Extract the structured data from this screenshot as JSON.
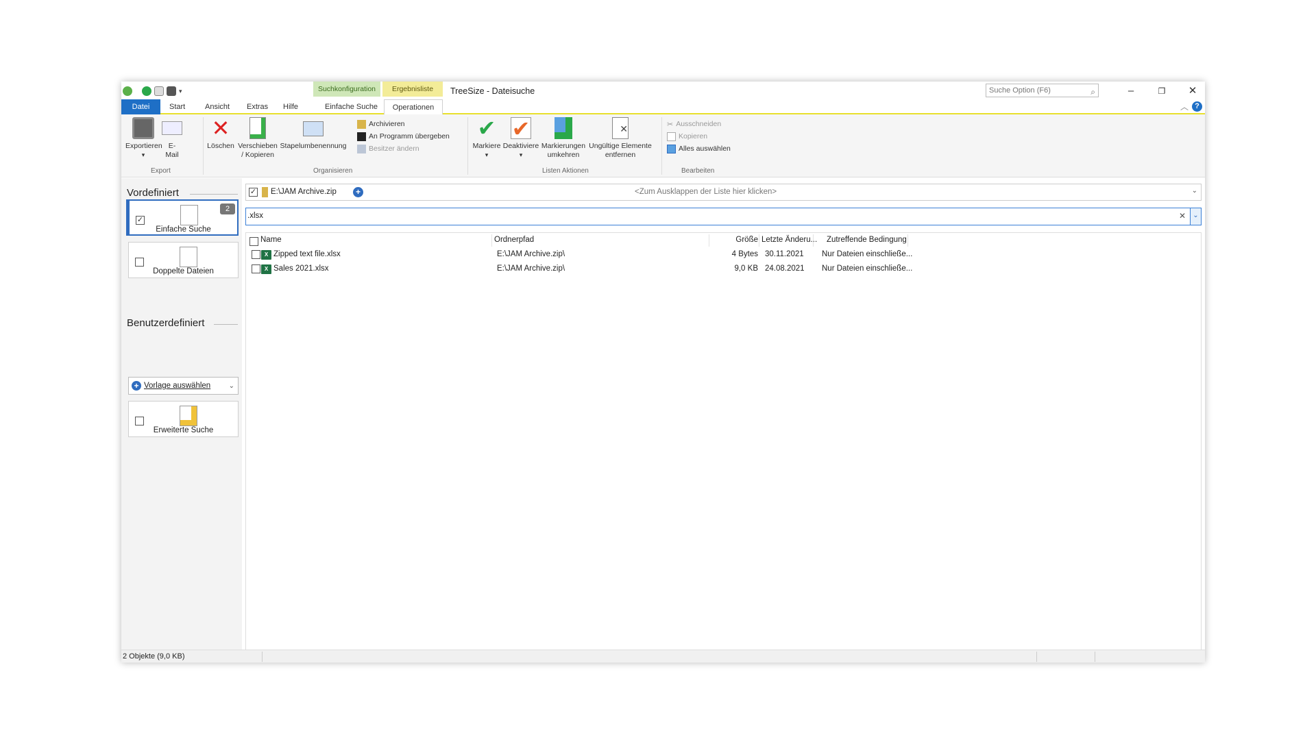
{
  "window": {
    "app_title": "TreeSize - Dateisuche",
    "context_tabs": [
      "Suchkonfiguration",
      "Ergebnisliste"
    ],
    "option_search_placeholder": "Suche Option (F6)"
  },
  "tabs": [
    "Datei",
    "Start",
    "Ansicht",
    "Extras",
    "Hilfe",
    "Einfache Suche",
    "Operationen"
  ],
  "active_tab": "Operationen",
  "ribbon": {
    "export": {
      "group": "Export",
      "exportieren": "Exportieren",
      "email_l1": "E-",
      "email_l2": "Mail"
    },
    "organisieren": {
      "group": "Organisieren",
      "loeschen": "Löschen",
      "verschieben_l1": "Verschieben",
      "verschieben_l2": "/ Kopieren",
      "stapel": "Stapelumbenennung",
      "archivieren": "Archivieren",
      "an_programm": "An Programm übergeben",
      "besitzer": "Besitzer ändern"
    },
    "listen": {
      "group": "Listen Aktionen",
      "markiere": "Markiere",
      "deaktiviere": "Deaktiviere",
      "markierungen_l1": "Markierungen",
      "markierungen_l2": "umkehren",
      "ungueltige_l1": "Ungültige Elemente",
      "ungueltige_l2": "entfernen"
    },
    "bearbeiten": {
      "group": "Bearbeiten",
      "ausschneiden": "Ausschneiden",
      "kopieren": "Kopieren",
      "alles": "Alles auswählen"
    }
  },
  "left": {
    "predefined_title": "Vordefiniert",
    "custom_title": "Benutzerdefiniert",
    "cards": [
      {
        "label": "Einfache Suche",
        "badge": "2",
        "checked": true
      },
      {
        "label": "Doppelte Dateien",
        "checked": false
      },
      {
        "label": "Erweiterte Suche",
        "checked": false
      }
    ],
    "template_select": "Vorlage auswählen"
  },
  "path_bar": {
    "path": "E:\\JAM Archive.zip",
    "expand_hint": "<Zum Ausklappen der Liste hier klicken>"
  },
  "filter": {
    "value": ".xlsx"
  },
  "table": {
    "columns": [
      "Name",
      "Ordnerpfad",
      "Größe",
      "Letzte Änderu...",
      "Zutreffende Bedingung"
    ],
    "rows": [
      {
        "name": "Zipped text file.xlsx",
        "path": "E:\\JAM Archive.zip\\",
        "size": "4 Bytes",
        "date": "30.11.2021",
        "condition": "Nur Dateien einschließe..."
      },
      {
        "name": "Sales 2021.xlsx",
        "path": "E:\\JAM Archive.zip\\",
        "size": "9,0 KB",
        "date": "24.08.2021",
        "condition": "Nur Dateien einschließe..."
      }
    ]
  },
  "status": {
    "text": "2 Objekte (9,0 KB)"
  },
  "colors": {
    "accent": "#1e6fc6",
    "ctx_green": "#cfe7b8",
    "ctx_yellow": "#f3ec98",
    "excel": "#1f7244"
  }
}
